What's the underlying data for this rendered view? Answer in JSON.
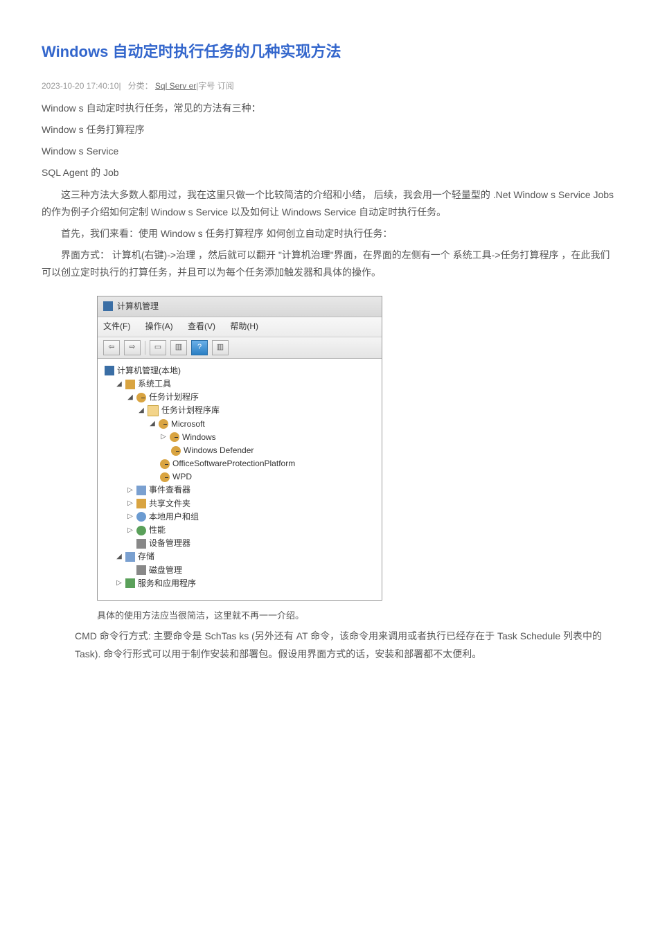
{
  "title": "Windows 自动定时执行任务的几种实现方法",
  "meta": {
    "date": "2023-10-20 17:40:10",
    "category_label": "分类：",
    "category_link": "Sql Serv er",
    "tail": "|字号 订阅"
  },
  "body": {
    "p1": "Window s 自动定时执行任务，常见的方法有三种：",
    "p2": "Window s 任务打算程序",
    "p3": "Window s Service",
    "p4": "SQL Agent 的  Job",
    "p5": "这三种方法大多数人都用过，我在这里只做一个比较简洁的介绍和小结， 后续，我会用一个轻量型的 .Net Window s Service Jobs 的作为例子介绍如何定制  Window s Service 以及如何让  Windows Service 自动定时执行任务。",
    "p6": "首先，我们来看：使用  Window s 任务打算程序  如何创立自动定时执行任务：",
    "p7": "界面方式： 计算机(右键)->治理 ，然后就可以翻开 \"计算机治理\"界面，在界面的左侧有一个  系统工具->任务打算程序 ，在此我们可以创立定时执行的打算任务，并且可以为每个任务添加触发器和具体的操作。"
  },
  "screenshot": {
    "window_title": "计算机管理",
    "menu": {
      "file": "文件(F)",
      "action": "操作(A)",
      "view": "查看(V)",
      "help": "帮助(H)"
    },
    "tree": {
      "root": "计算机管理(本地)",
      "system_tools": "系统工具",
      "task_scheduler": "任务计划程序",
      "task_scheduler_lib": "任务计划程序库",
      "microsoft": "Microsoft",
      "windows": "Windows",
      "windows_defender": "Windows Defender",
      "office_spp": "OfficeSoftwareProtectionPlatform",
      "wpd": "WPD",
      "event_viewer": "事件查看器",
      "shared_folders": "共享文件夹",
      "local_users": "本地用户和组",
      "performance": "性能",
      "device_mgr": "设备管理器",
      "storage": "存储",
      "disk_mgmt": "磁盘管理",
      "services_apps": "服务和应用程序"
    }
  },
  "after": {
    "caption": "具体的使用方法应当很简洁，这里就不再一一介绍。",
    "cmd": "CMD 命令行方式: 主要命令是  SchTas ks (另外还有  AT 命令，该命令用来调用或者执行已经存在于 Task Schedule 列表中的 Task). 命令行形式可以用于制作安装和部署包。假设用界面方式的话，安装和部署都不太便利。"
  }
}
